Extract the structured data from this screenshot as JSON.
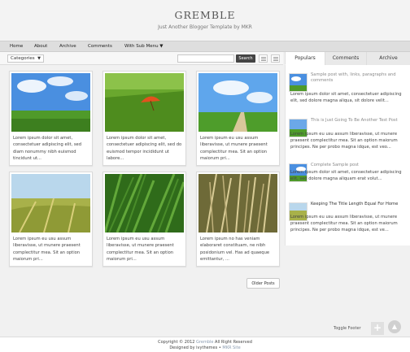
{
  "header": {
    "title": "GREMBLE",
    "tagline": "Just Another Blogger Template by MKR"
  },
  "nav": {
    "items": [
      {
        "label": "Home"
      },
      {
        "label": "About"
      },
      {
        "label": "Archive"
      },
      {
        "label": "Comments"
      },
      {
        "label": "With Sub Menu ▼"
      }
    ]
  },
  "toolbar": {
    "categories_label": "Categories",
    "search_placeholder": "",
    "search_button": "Search"
  },
  "posts": [
    {
      "excerpt": "Lorem ipsum dolor sit amet, consectetuer adipiscing elit, sed diam nonummy nibh euismod tincidunt ut...",
      "image": "sky-field"
    },
    {
      "excerpt": "Lorem ipsum dolor sit amet, consectetuer adipiscing elit, sed do euismod tempor incididunt ut labore...",
      "image": "grass-umbrella"
    },
    {
      "excerpt": "Lorem ipsum eu usu assum liberavisse, ut munere praesent complectitur mea. Sit an option maiorum pri...",
      "image": "road-field"
    },
    {
      "excerpt": "Lorem ipsum eu usu assum liberavisse, ut munere praesent complectitur mea. Sit an option maiorum pri...",
      "image": "wheat"
    },
    {
      "excerpt": "Lorem ipsum eu usu assum liberavisse, ut munere praesent complectitur mea. Sit an option maiorum pri...",
      "image": "grass-dew"
    },
    {
      "excerpt": "Lorem ipsum no has veniam elaboraret constituam, ne nibh posidonium vel. Has ad quaeque emittantur, ...",
      "image": "dry-grass"
    }
  ],
  "pagination": {
    "older_label": "Older Posts"
  },
  "sidebar": {
    "tabs": [
      {
        "label": "Populars",
        "active": true
      },
      {
        "label": "Comments",
        "active": false
      },
      {
        "label": "Archive",
        "active": false
      }
    ],
    "items": [
      {
        "title": "Sample post with, links, paragraphs and comments",
        "text": "Lorem ipsum dolor sit amet, consectetuer adipiscing elit, sed dolore magna aliqua, sit dolore velit...",
        "image": "sky-field"
      },
      {
        "title": "This is Just Going To Be Another Test Post",
        "text": "Lorem ipsum eu usu assum liberavisse, ut munere praesent complectitur mea. Sit an option maiorum principes. Ne per probo magna idque, est veo...",
        "image": "grass-field"
      },
      {
        "title": "Complete Sample post",
        "text": "Lorem ipsum dolor sit amet, consectetuer adipiscing elit, sed dolore magna aliquam erat volut...",
        "image": "sky-field"
      },
      {
        "title": "Keeping The Title Length Equal For Home",
        "text": "Lorem ipsum eu usu assum liberavisse, ut munere praesent complectitur mea. Sit an option maiorum principes. Ne per probo magna idque, est ve...",
        "image": "wheat"
      }
    ]
  },
  "footer": {
    "toggle_label": "Toggle Footer",
    "plus_icon": "+",
    "up_icon": "▲",
    "copyright_prefix": "Copyright © 2012",
    "site_link": "Gremble",
    "rights": "All Right Reserved",
    "designed_prefix": "Designed by",
    "designer": "ivythemes",
    "separator": "•",
    "mkr_link": "MKR Site"
  }
}
